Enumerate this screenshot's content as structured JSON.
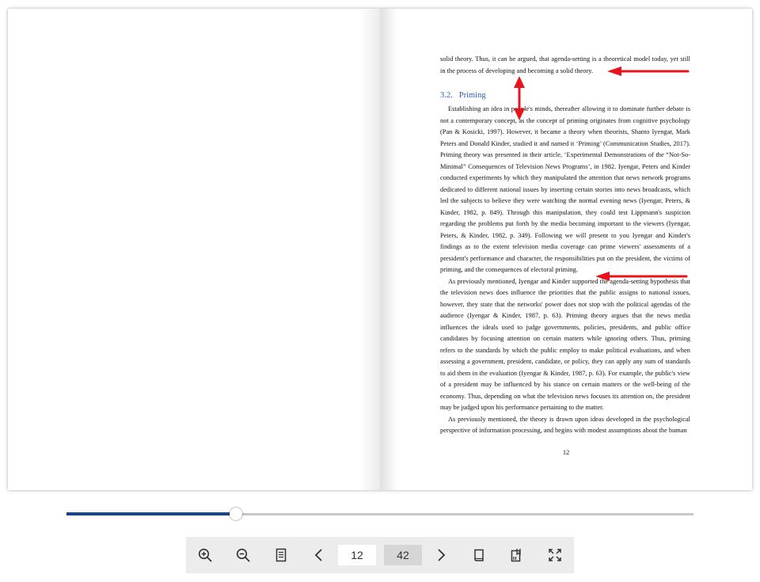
{
  "viewer": {
    "current_page": "12",
    "total_pages": "42",
    "progress": 0.27
  },
  "right_page": {
    "opening_lines": [
      "solid theory. Thus, it can be argued, that agenda-setting is a theoretical model today, yet still",
      "in the process of developing and becoming a solid theory."
    ],
    "section_number": "3.2.",
    "section_title": "Priming",
    "paragraph_1": [
      "Establishing an idea in people's minds, thereafter allowing it to dominate further debate is",
      "not a contemporary concept, as the concept of priming originates from cognitive psychology",
      "(Pan & Kosicki, 1997). However, it became a theory when theorists, Shanto Iyengar, Mark",
      "Peters and Donald Kinder, studied it and named it ‘Priming’ (Communication Studies, 2017).",
      "Priming theory was presented in their article, ‘Experimental Demonstrations of the “Not-So-",
      "Minimal” Consequences of Television News Programs’, in 1982. Iyengar, Peters and Kinder",
      "conducted experiments by which they manipulated the attention that news network programs",
      "dedicated to different national issues by inserting certain stories into news broadcasts, which",
      "led the subjects to believe they were watching the normal evening news (Iyengar, Peters, &",
      "Kinder, 1982, p. 849). Through this manipulation, they could test Lippmann's suspicion",
      "regarding the problems put forth by the media becoming important to the viewers (Iyengar,",
      "Peters, & Kinder, 1982, p. 349). Following we will present to you Iyengar and Kinder's",
      "findings as to the extent television media coverage can prime viewers' assessments of a",
      "president's performance and character, the responsibilities put on the president, the victims of",
      "priming, and the consequences of electoral priming."
    ],
    "paragraph_2": [
      "As previously mentioned, Iyengar and Kinder supported the agenda-setting hypothesis that",
      "the television news does influence the priorities that the public assigns to national issues,",
      "however, they state that the networks' power does not stop with the political agendas of the",
      "audience (Iyengar & Kinder, 1987, p. 63). Priming theory argues that the news media",
      "influences the ideals used to judge governments, policies, presidents, and public office",
      "candidates by focusing attention on certain matters while ignoring others. Thus, priming",
      "refers to the standards by which the public employ to make political evaluations, and when",
      "assessing a government, president, candidate, or policy, they can apply any sum of standards",
      "to aid them in the evaluation (Iyengar & Kinder, 1987, p. 63). For example, the public's view",
      "of a president may be influenced by his stance on certain matters or the well-being of the",
      "economy. Thus, depending on what the television news focuses its attention on, the president",
      "may be judged upon his performance pertaining to the matter."
    ],
    "paragraph_3": [
      "As previously mentioned, the theory is drawn upon ideas developed in the psychological",
      "perspective of information processing, and begins with modest assumptions about the human"
    ],
    "page_number": "12"
  },
  "colors": {
    "annotation_arrow": "#e8141b",
    "section_heading": "#2e5cb8",
    "progress_fill": "#17468c",
    "toolbar_bg": "#ececec"
  },
  "toolbar": {
    "icons": [
      "zoom-in-icon",
      "zoom-out-icon",
      "single-page-icon",
      "chevron-left-icon",
      "chevron-right-icon",
      "book-icon",
      "bookmark-pages-icon",
      "fullscreen-icon"
    ]
  }
}
